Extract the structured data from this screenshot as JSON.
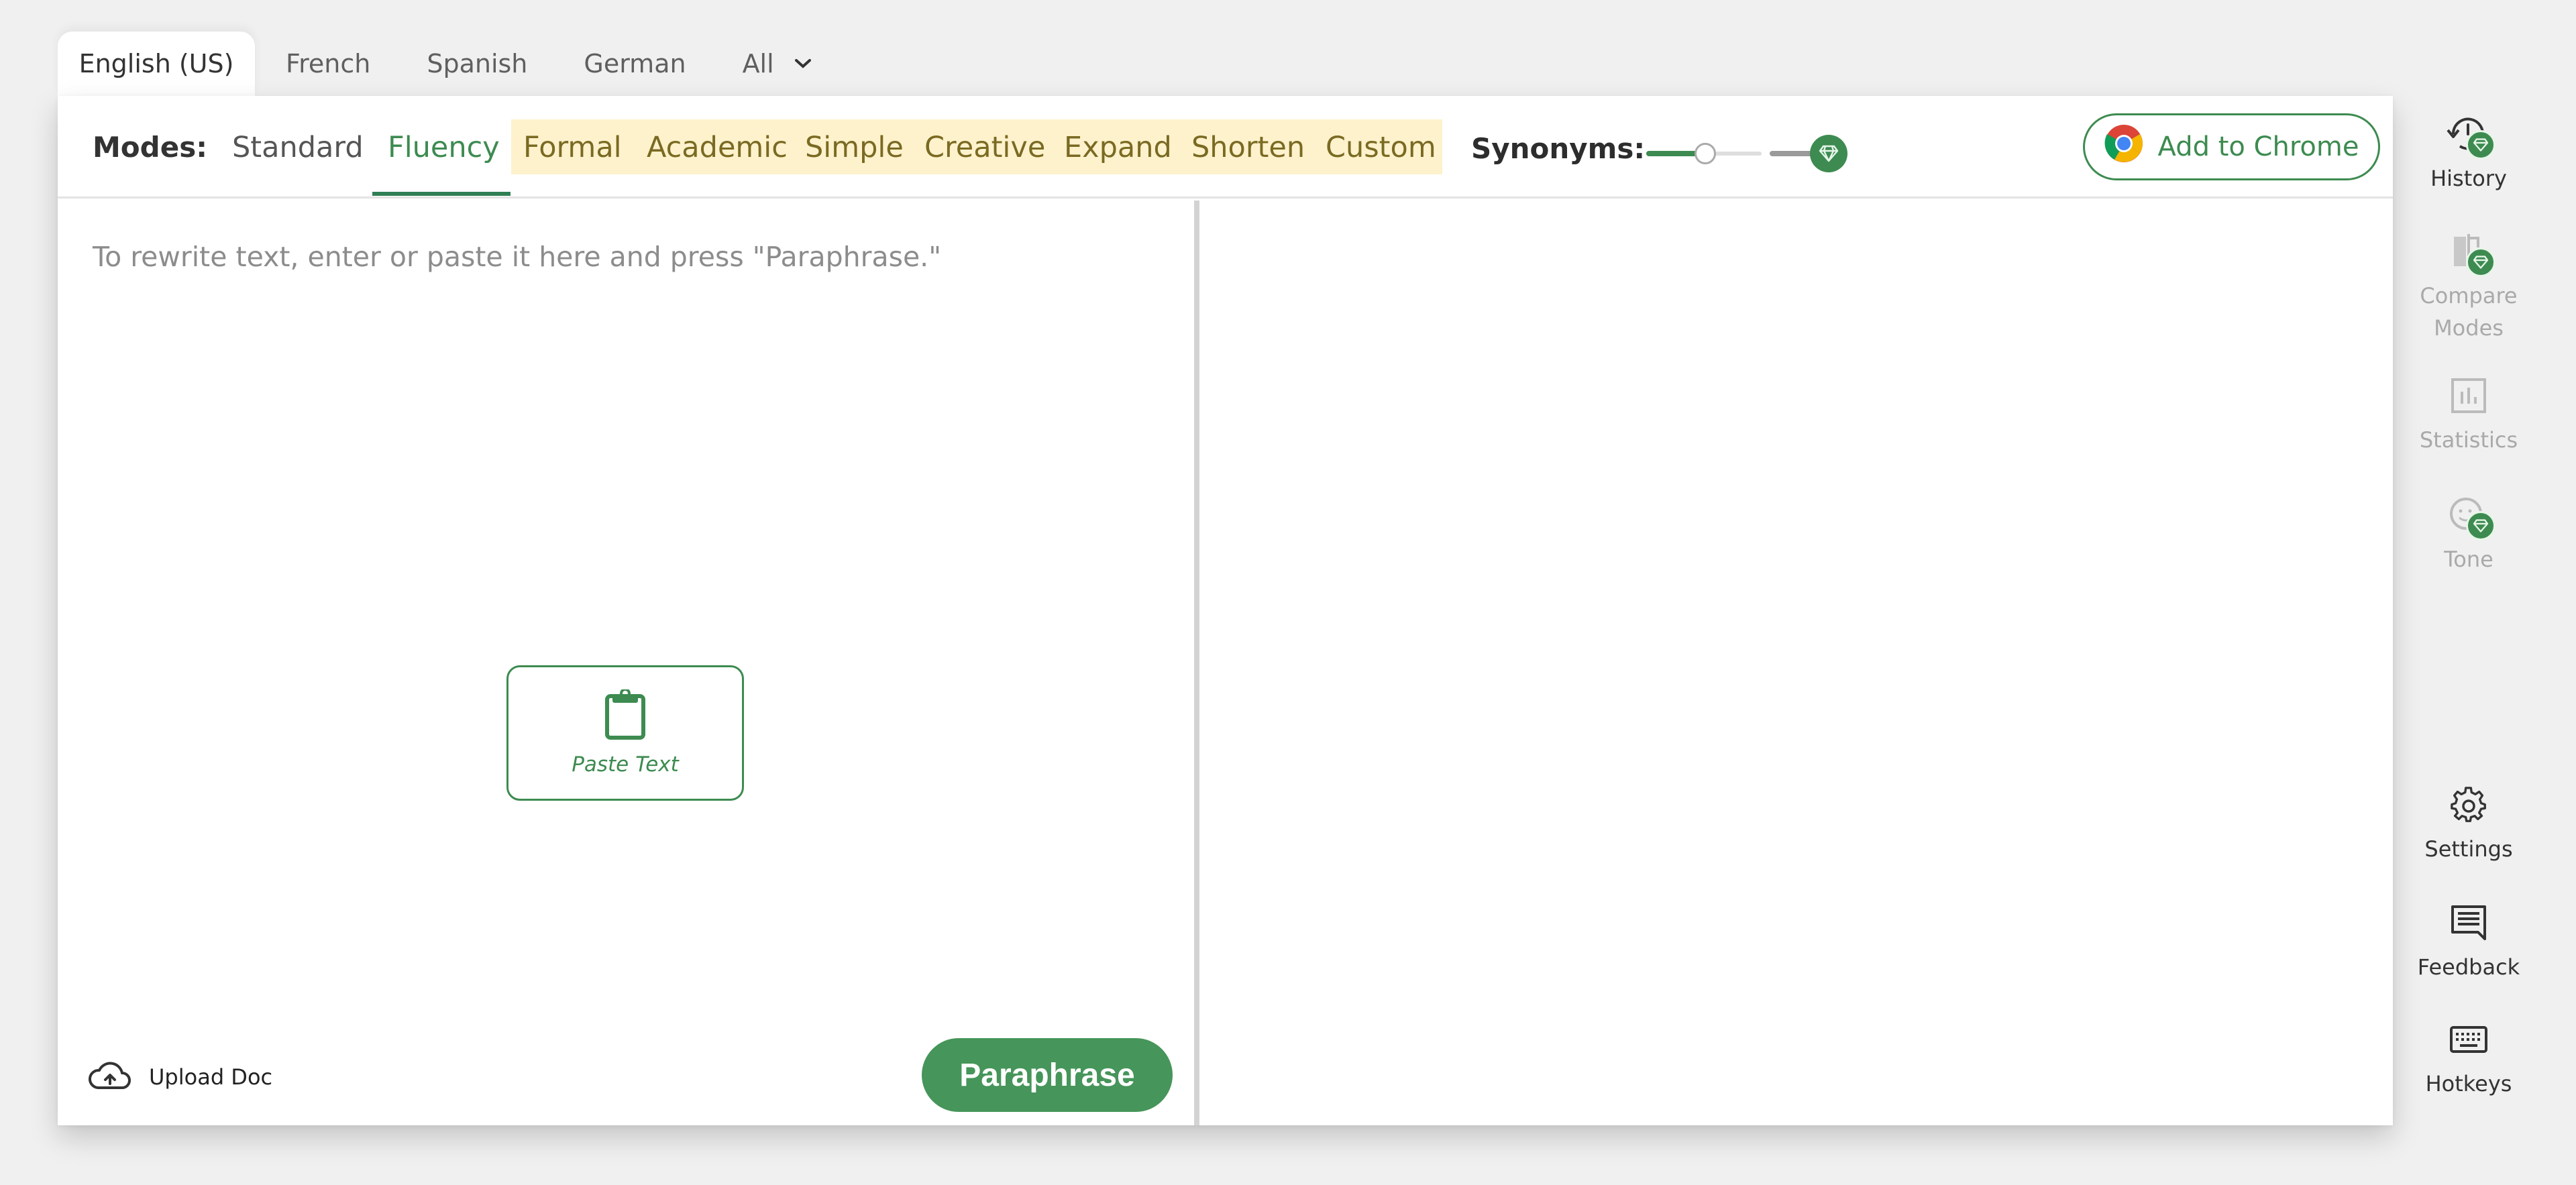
{
  "language_tabs": {
    "items": [
      {
        "label": "English (US)",
        "active": true
      },
      {
        "label": "French",
        "active": false
      },
      {
        "label": "Spanish",
        "active": false
      },
      {
        "label": "German",
        "active": false
      }
    ],
    "more_dropdown": {
      "label": "All",
      "icon": "chevron-down-icon"
    }
  },
  "toolbar": {
    "modes_label": "Modes:",
    "modes": [
      {
        "label": "Standard",
        "tier": "free",
        "active": false
      },
      {
        "label": "Fluency",
        "tier": "free",
        "active": true
      },
      {
        "label": "Formal",
        "tier": "premium",
        "active": false
      },
      {
        "label": "Academic",
        "tier": "premium",
        "active": false
      },
      {
        "label": "Simple",
        "tier": "premium",
        "active": false
      },
      {
        "label": "Creative",
        "tier": "premium",
        "active": false
      },
      {
        "label": "Expand",
        "tier": "premium",
        "active": false
      },
      {
        "label": "Shorten",
        "tier": "premium",
        "active": false
      },
      {
        "label": "Custom",
        "tier": "premium",
        "active": false
      }
    ],
    "synonyms": {
      "label": "Synonyms:",
      "free_level": 2,
      "free_max": 4,
      "premium_icon": "gem-icon"
    },
    "add_to_chrome": {
      "label": "Add to Chrome",
      "icon": "chrome-icon"
    }
  },
  "editor": {
    "input_placeholder": "To rewrite text, enter or paste it here and press \"Paraphrase.\"",
    "input_value": "",
    "paste_button": {
      "label": "Paste Text",
      "icon": "clipboard-icon"
    },
    "upload_button": {
      "label": "Upload Doc",
      "icon": "cloud-upload-icon"
    },
    "paraphrase_button": {
      "label": "Paraphrase"
    },
    "output_value": ""
  },
  "sidebar": {
    "items": [
      {
        "label": "History",
        "icon": "history-icon",
        "premium": true,
        "disabled": false
      },
      {
        "label": "Compare Modes",
        "icon": "compare-modes-icon",
        "premium": true,
        "disabled": true
      },
      {
        "label": "Statistics",
        "icon": "statistics-icon",
        "premium": false,
        "disabled": true
      },
      {
        "label": "Tone",
        "icon": "tone-icon",
        "premium": true,
        "disabled": true
      },
      {
        "label": "Settings",
        "icon": "gear-icon",
        "premium": false,
        "disabled": false
      },
      {
        "label": "Feedback",
        "icon": "feedback-icon",
        "premium": false,
        "disabled": false
      },
      {
        "label": "Hotkeys",
        "icon": "keyboard-icon",
        "premium": false,
        "disabled": false
      }
    ]
  },
  "colors": {
    "brand_green": "#3d8b50",
    "paraphrase_button": "#46955a",
    "premium_mode_bg": "#fdf2cc",
    "premium_mode_text": "#7a6a22",
    "page_bg": "#f0f0f0"
  }
}
